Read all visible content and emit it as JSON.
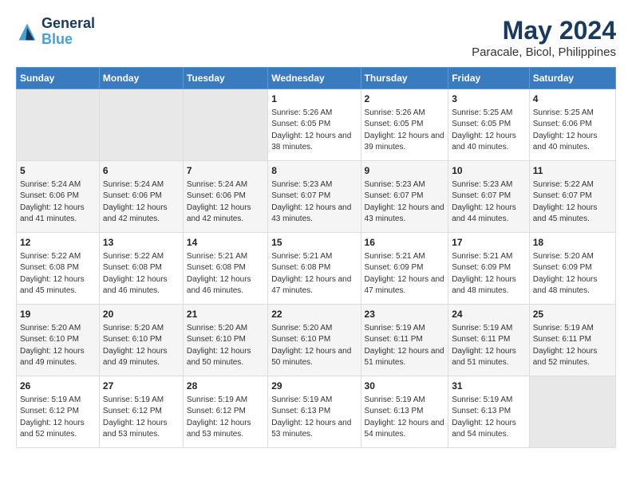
{
  "logo": {
    "text_general": "General",
    "text_blue": "Blue"
  },
  "header": {
    "title": "May 2024",
    "subtitle": "Paracale, Bicol, Philippines"
  },
  "weekdays": [
    "Sunday",
    "Monday",
    "Tuesday",
    "Wednesday",
    "Thursday",
    "Friday",
    "Saturday"
  ],
  "weeks": [
    {
      "days": [
        {
          "num": "",
          "empty": true
        },
        {
          "num": "",
          "empty": true
        },
        {
          "num": "",
          "empty": true
        },
        {
          "num": "1",
          "sunrise": "5:26 AM",
          "sunset": "6:05 PM",
          "daylight": "12 hours and 38 minutes."
        },
        {
          "num": "2",
          "sunrise": "5:26 AM",
          "sunset": "6:05 PM",
          "daylight": "12 hours and 39 minutes."
        },
        {
          "num": "3",
          "sunrise": "5:25 AM",
          "sunset": "6:05 PM",
          "daylight": "12 hours and 40 minutes."
        },
        {
          "num": "4",
          "sunrise": "5:25 AM",
          "sunset": "6:06 PM",
          "daylight": "12 hours and 40 minutes."
        }
      ]
    },
    {
      "days": [
        {
          "num": "5",
          "sunrise": "5:24 AM",
          "sunset": "6:06 PM",
          "daylight": "12 hours and 41 minutes."
        },
        {
          "num": "6",
          "sunrise": "5:24 AM",
          "sunset": "6:06 PM",
          "daylight": "12 hours and 42 minutes."
        },
        {
          "num": "7",
          "sunrise": "5:24 AM",
          "sunset": "6:06 PM",
          "daylight": "12 hours and 42 minutes."
        },
        {
          "num": "8",
          "sunrise": "5:23 AM",
          "sunset": "6:07 PM",
          "daylight": "12 hours and 43 minutes."
        },
        {
          "num": "9",
          "sunrise": "5:23 AM",
          "sunset": "6:07 PM",
          "daylight": "12 hours and 43 minutes."
        },
        {
          "num": "10",
          "sunrise": "5:23 AM",
          "sunset": "6:07 PM",
          "daylight": "12 hours and 44 minutes."
        },
        {
          "num": "11",
          "sunrise": "5:22 AM",
          "sunset": "6:07 PM",
          "daylight": "12 hours and 45 minutes."
        }
      ]
    },
    {
      "days": [
        {
          "num": "12",
          "sunrise": "5:22 AM",
          "sunset": "6:08 PM",
          "daylight": "12 hours and 45 minutes."
        },
        {
          "num": "13",
          "sunrise": "5:22 AM",
          "sunset": "6:08 PM",
          "daylight": "12 hours and 46 minutes."
        },
        {
          "num": "14",
          "sunrise": "5:21 AM",
          "sunset": "6:08 PM",
          "daylight": "12 hours and 46 minutes."
        },
        {
          "num": "15",
          "sunrise": "5:21 AM",
          "sunset": "6:08 PM",
          "daylight": "12 hours and 47 minutes."
        },
        {
          "num": "16",
          "sunrise": "5:21 AM",
          "sunset": "6:09 PM",
          "daylight": "12 hours and 47 minutes."
        },
        {
          "num": "17",
          "sunrise": "5:21 AM",
          "sunset": "6:09 PM",
          "daylight": "12 hours and 48 minutes."
        },
        {
          "num": "18",
          "sunrise": "5:20 AM",
          "sunset": "6:09 PM",
          "daylight": "12 hours and 48 minutes."
        }
      ]
    },
    {
      "days": [
        {
          "num": "19",
          "sunrise": "5:20 AM",
          "sunset": "6:10 PM",
          "daylight": "12 hours and 49 minutes."
        },
        {
          "num": "20",
          "sunrise": "5:20 AM",
          "sunset": "6:10 PM",
          "daylight": "12 hours and 49 minutes."
        },
        {
          "num": "21",
          "sunrise": "5:20 AM",
          "sunset": "6:10 PM",
          "daylight": "12 hours and 50 minutes."
        },
        {
          "num": "22",
          "sunrise": "5:20 AM",
          "sunset": "6:10 PM",
          "daylight": "12 hours and 50 minutes."
        },
        {
          "num": "23",
          "sunrise": "5:19 AM",
          "sunset": "6:11 PM",
          "daylight": "12 hours and 51 minutes."
        },
        {
          "num": "24",
          "sunrise": "5:19 AM",
          "sunset": "6:11 PM",
          "daylight": "12 hours and 51 minutes."
        },
        {
          "num": "25",
          "sunrise": "5:19 AM",
          "sunset": "6:11 PM",
          "daylight": "12 hours and 52 minutes."
        }
      ]
    },
    {
      "days": [
        {
          "num": "26",
          "sunrise": "5:19 AM",
          "sunset": "6:12 PM",
          "daylight": "12 hours and 52 minutes."
        },
        {
          "num": "27",
          "sunrise": "5:19 AM",
          "sunset": "6:12 PM",
          "daylight": "12 hours and 53 minutes."
        },
        {
          "num": "28",
          "sunrise": "5:19 AM",
          "sunset": "6:12 PM",
          "daylight": "12 hours and 53 minutes."
        },
        {
          "num": "29",
          "sunrise": "5:19 AM",
          "sunset": "6:13 PM",
          "daylight": "12 hours and 53 minutes."
        },
        {
          "num": "30",
          "sunrise": "5:19 AM",
          "sunset": "6:13 PM",
          "daylight": "12 hours and 54 minutes."
        },
        {
          "num": "31",
          "sunrise": "5:19 AM",
          "sunset": "6:13 PM",
          "daylight": "12 hours and 54 minutes."
        },
        {
          "num": "",
          "empty": true
        }
      ]
    }
  ],
  "labels": {
    "sunrise_prefix": "Sunrise: ",
    "sunset_prefix": "Sunset: ",
    "daylight_prefix": "Daylight: "
  }
}
